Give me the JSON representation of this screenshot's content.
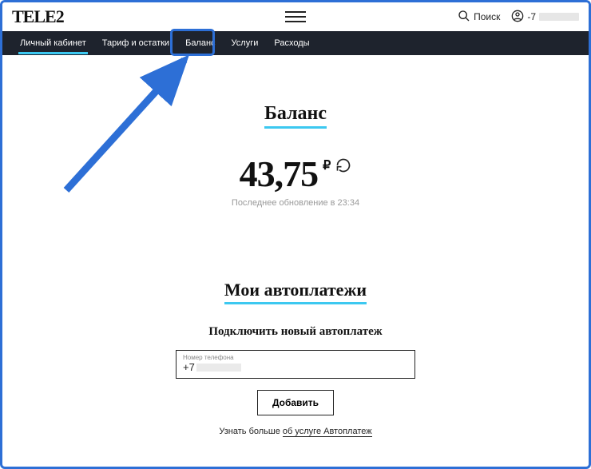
{
  "header": {
    "logo": "TELE2",
    "search_label": "Поиск",
    "phone_prefix": "-7"
  },
  "nav": {
    "items": [
      {
        "label": "Личный кабинет"
      },
      {
        "label": "Тариф и остатки"
      },
      {
        "label": "Баланс"
      },
      {
        "label": "Услуги"
      },
      {
        "label": "Расходы"
      }
    ]
  },
  "balance": {
    "title": "Баланс",
    "amount": "43,75",
    "currency": "₽",
    "updated": "Последнее обновление в 23:34"
  },
  "autopay": {
    "title": "Мои автоплатежи",
    "subtitle": "Подключить новый автоплатеж",
    "phone_label": "Номер телефона",
    "phone_value_prefix": "+7",
    "add_button": "Добавить",
    "more_text": "Узнать больше ",
    "more_link": "об услуге Автоплатеж"
  }
}
